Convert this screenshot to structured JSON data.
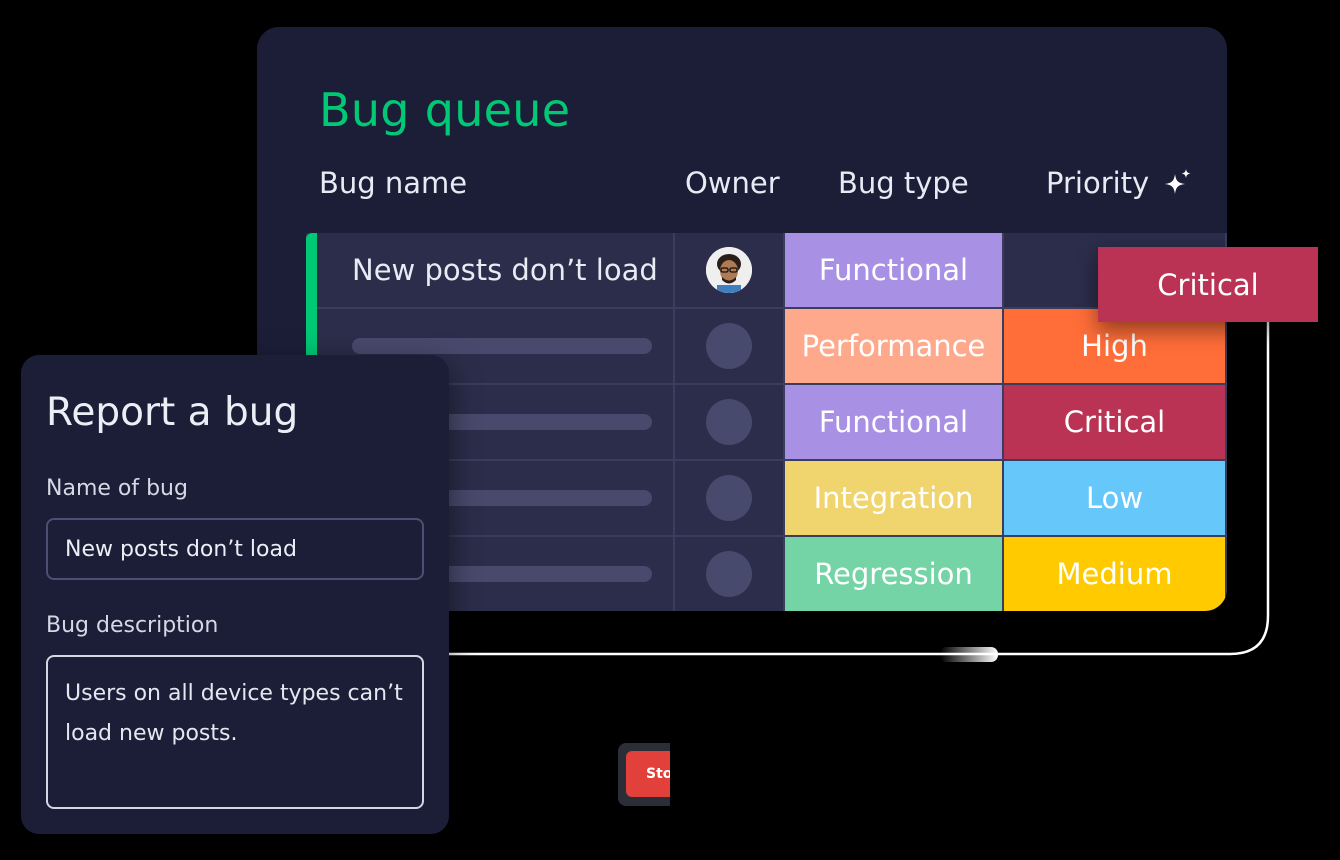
{
  "board": {
    "title": "Bug queue",
    "columns": {
      "name": "Bug name",
      "owner": "Owner",
      "type": "Bug type",
      "priority": "Priority"
    },
    "rows": [
      {
        "name": "New posts don’t load",
        "owner": "avatar",
        "type": "Functional",
        "type_color": "#a890e4",
        "priority": "",
        "priority_color": ""
      },
      {
        "name": "",
        "owner": "placeholder",
        "type": "Performance",
        "type_color": "#ffa98c",
        "priority": "High",
        "priority_color": "#ff6d38"
      },
      {
        "name": "",
        "owner": "placeholder",
        "type": "Functional",
        "type_color": "#a890e4",
        "priority": "Critical",
        "priority_color": "#bb3354"
      },
      {
        "name": "",
        "owner": "placeholder",
        "type": "Integration",
        "type_color": "#f0d46e",
        "priority": "Low",
        "priority_color": "#66c7fb"
      },
      {
        "name": "",
        "owner": "placeholder",
        "type": "Regression",
        "type_color": "#74d4a5",
        "priority": "Medium",
        "priority_color": "#ffcb00"
      }
    ],
    "floating_priority": {
      "label": "Critical",
      "color": "#bb3354"
    },
    "accent_color": "#00c875"
  },
  "report": {
    "title": "Report a bug",
    "name_label": "Name of bug",
    "name_value": "New posts don’t load",
    "description_label": "Bug description",
    "description_value": "Users on all device types can’t load new posts."
  },
  "widget": {
    "stop_label": "Sto"
  }
}
